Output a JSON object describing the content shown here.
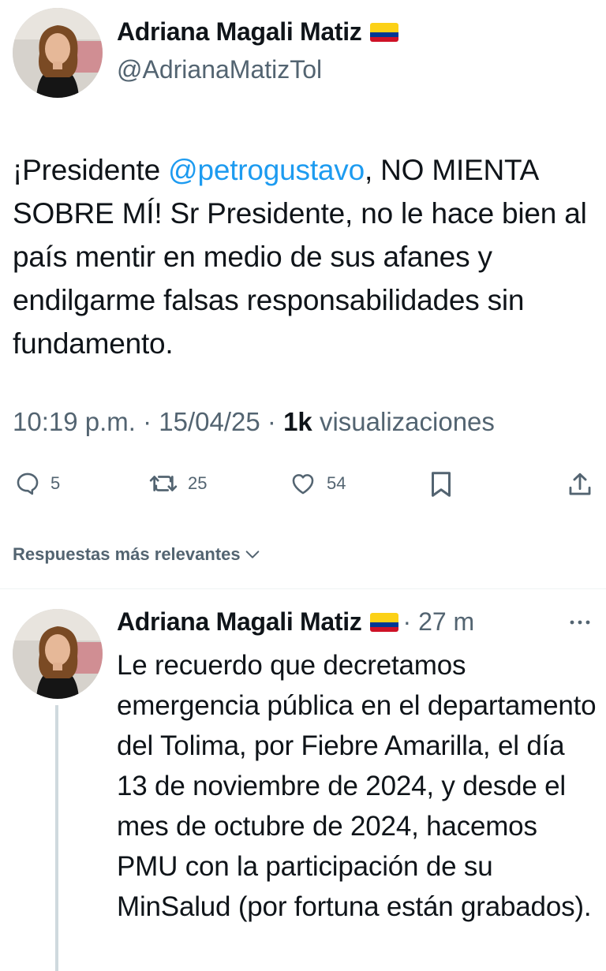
{
  "main_tweet": {
    "author": {
      "name": "Adriana Magali Matiz",
      "handle": "@AdrianaMatizTol",
      "flag_colors": [
        "#fcd116",
        "#003893",
        "#ce1126"
      ]
    },
    "text_before_mention": "¡Presidente ",
    "mention": "@petrogustavo",
    "text_after_mention": ", NO MIENTA SOBRE MÍ! Sr Presidente, no le hace bien al país mentir en medio de sus afanes y endilgarme falsas responsabilidades sin fundamento.",
    "time": "10:19 p.m.",
    "separator": " · ",
    "date": "15/04/25",
    "views_count": "1k",
    "views_label": " visualizaciones",
    "actions": {
      "replies": "5",
      "retweets": "25",
      "likes": "54"
    }
  },
  "sort": {
    "label": "Respuestas más relevantes"
  },
  "reply": {
    "author": {
      "name": "Adriana Magali Matiz"
    },
    "time": "· 27 m",
    "text": "Le recuerdo que decretamos emergencia pública en el departamento del Tolima, por Fiebre Amarilla, el día 13 de noviembre de 2024, y desde el mes de octubre de 2024, hacemos PMU con la participación de su MinSalud (por fortuna están grabados)."
  },
  "colors": {
    "text": "#0f1419",
    "muted": "#536471",
    "link": "#1d9bf0",
    "divider": "#eff3f4",
    "thread_line": "#cfd9de"
  },
  "icons": {
    "reply": "reply-bubble-icon",
    "retweet": "retweet-icon",
    "like": "heart-icon",
    "bookmark": "bookmark-icon",
    "share": "share-icon",
    "more": "more-dots-icon",
    "sort": "chevron-down-icon"
  }
}
